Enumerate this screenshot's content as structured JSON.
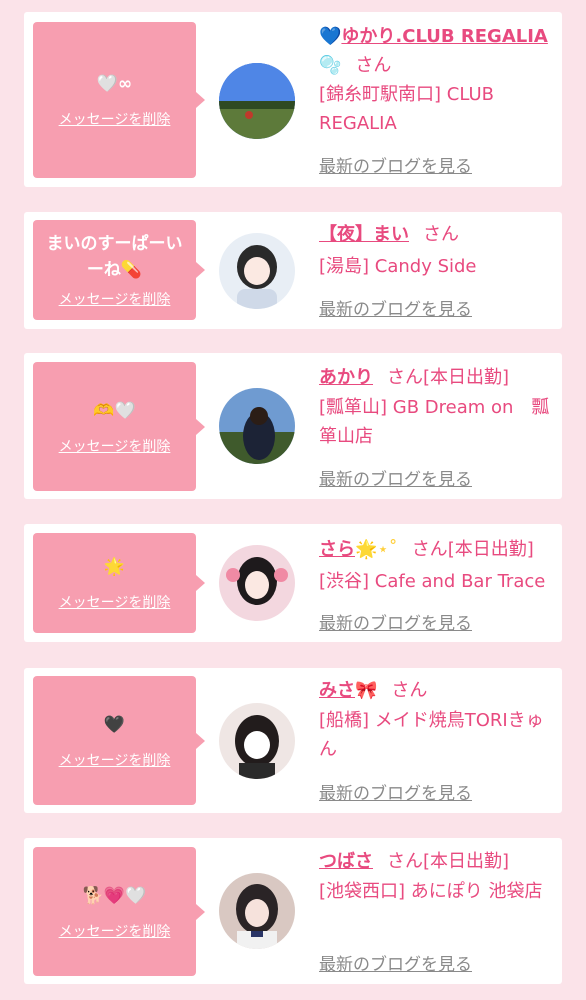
{
  "delete_label": "メッセージを削除",
  "blog_label": "最新のブログを見る",
  "san_label": "さん",
  "cards": [
    {
      "message": "🤍∞",
      "name_prefix": "💙",
      "name": "ゆかり.CLUB REGALIA",
      "name_suffix": "🫧",
      "status": "",
      "shop": "[錦糸町駅南口] CLUB REGALIA"
    },
    {
      "message": "まいのすーぱーいーね💊",
      "name_prefix": "",
      "name": "【夜】まい",
      "name_suffix": "",
      "status": "",
      "shop": "[湯島] Candy Side"
    },
    {
      "message": "🫶🤍",
      "name_prefix": "",
      "name": "あかり",
      "name_suffix": "",
      "status": "[本日出勤]",
      "shop": "[瓢箪山] GB Dream on　瓢箪山店"
    },
    {
      "message": "🌟",
      "name_prefix": "",
      "name": "さら",
      "name_suffix": "🌟⋆˚",
      "status": "[本日出勤]",
      "shop": "[渋谷] Cafe and Bar Trace"
    },
    {
      "message": "🖤",
      "name_prefix": "",
      "name": "みさ",
      "name_suffix": "🎀",
      "status": "",
      "shop": "[船橋] メイド焼鳥TORIきゅん"
    },
    {
      "message": "🐕💗🤍",
      "name_prefix": "",
      "name": "つばさ",
      "name_suffix": "",
      "status": "[本日出勤]",
      "shop": "[池袋西口] あにぽり 池袋店"
    }
  ]
}
